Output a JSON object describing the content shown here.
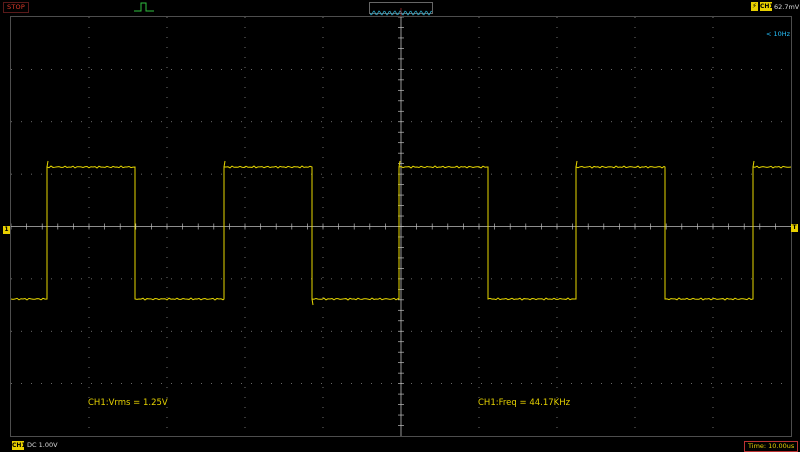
{
  "status": {
    "run_state": "STOP"
  },
  "trigger": {
    "source_label": "CH1",
    "level": "62.7mV",
    "edge_icon": "rising-edge-icon"
  },
  "screen": {
    "bandwidth_label": "< 10Hz"
  },
  "measurements": {
    "left": "CH1:Vrms = 1.25V",
    "right": "CH1:Freq = 44.17KHz"
  },
  "channel": {
    "tag": "CH1",
    "coupling": "DC",
    "scale": "1.00V",
    "ground_marker": "1"
  },
  "timebase": {
    "label": "Time: 10.00us"
  },
  "trigger_marker": "T",
  "colors": {
    "trace": "#e8d800",
    "grid": "#8a8a8a",
    "stop": "#e23b2b",
    "bandwidth": "#26c3ff",
    "background": "#000000"
  }
}
